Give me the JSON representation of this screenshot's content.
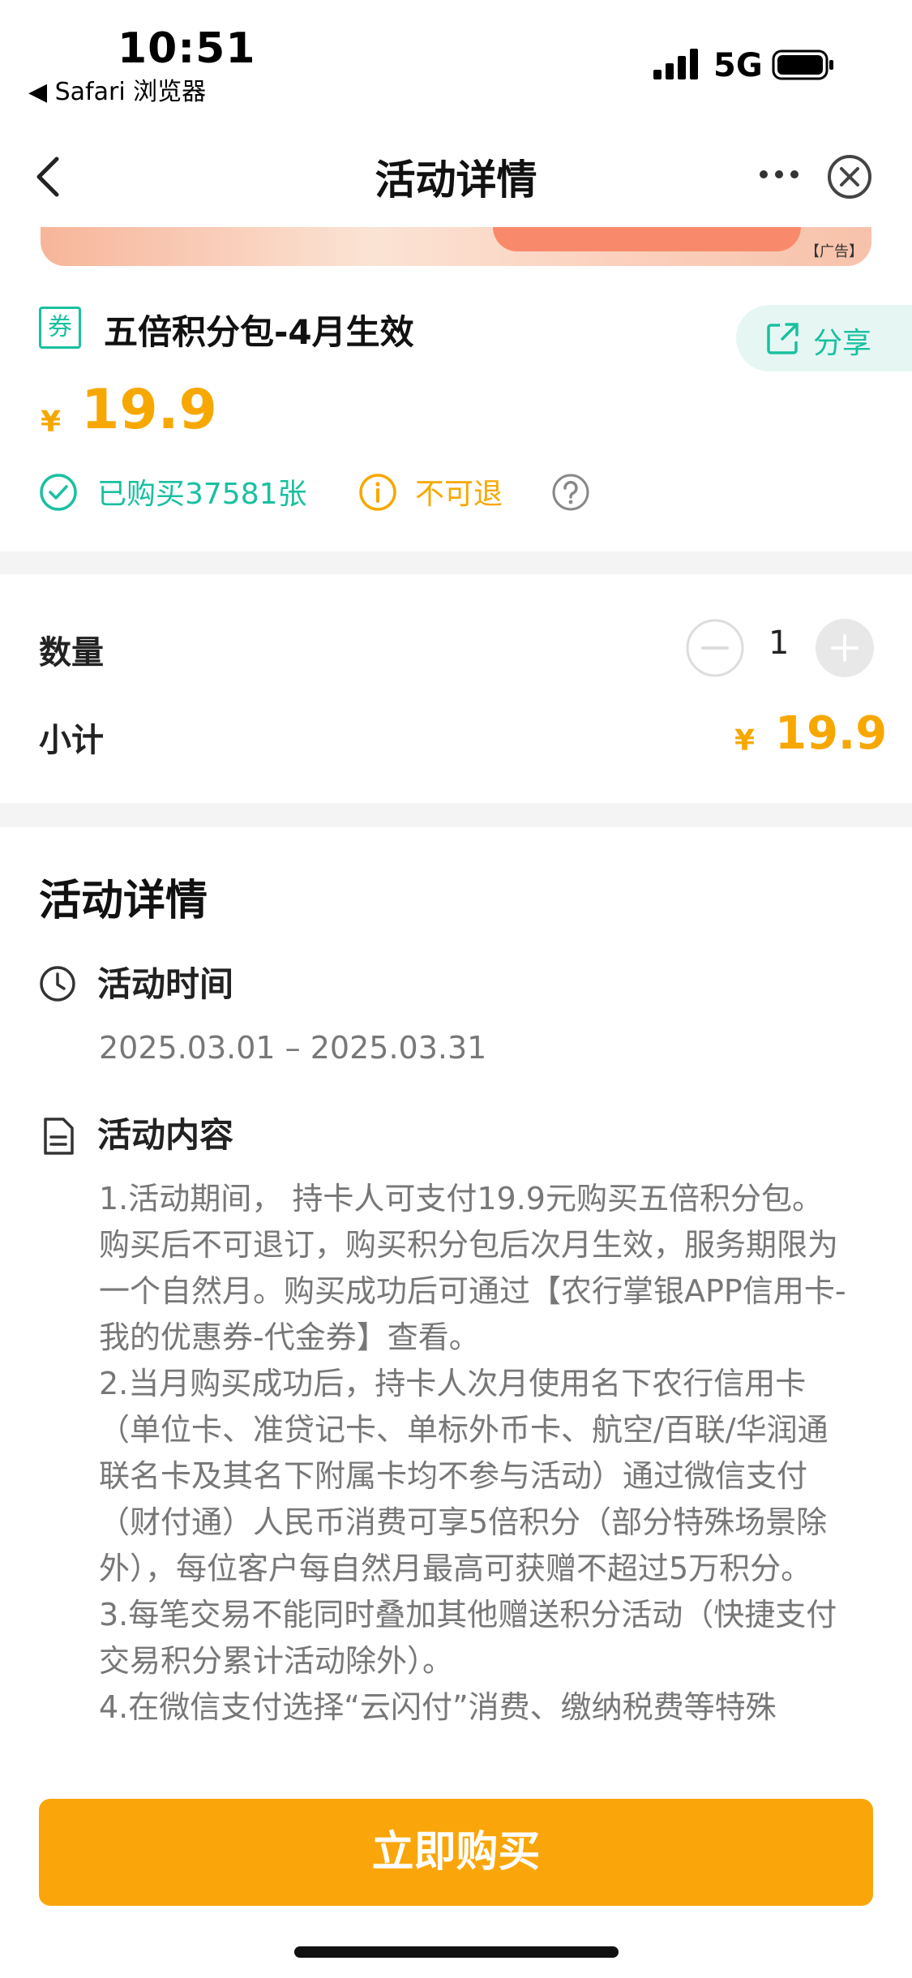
{
  "status_bar": {
    "time": "10:51",
    "back_app": "◀ Safari 浏览器",
    "network": "5G"
  },
  "nav": {
    "title": "活动详情"
  },
  "banner": {
    "ad_tag": "【广告】"
  },
  "product": {
    "coupon_icon_text": "券",
    "title": "五倍积分包-4月生效",
    "share_label": "分享",
    "currency": "¥",
    "price": "19.9",
    "sold": "已购买37581张",
    "refund": "不可退"
  },
  "order": {
    "quantity_label": "数量",
    "quantity": "1",
    "subtotal_label": "小计",
    "currency": "¥",
    "subtotal": "19.9"
  },
  "details": {
    "title": "活动详情",
    "time_label": "活动时间",
    "time_range": "2025.03.01 – 2025.03.31",
    "content_label": "活动内容",
    "content": [
      "1.活动期间， 持卡人可支付19.9元购买五倍积分包。购买后不可退订，购买积分包后次月生效，服务期限为一个自然月。购买成功后可通过【农行掌银APP信用卡-我的优惠券-代金券】查看。",
      "2.当月购买成功后，持卡人次月使用名下农行信用卡（单位卡、准贷记卡、单标外币卡、航空/百联/华润通联名卡及其名下附属卡均不参与活动）通过微信支付（财付通）人民币消费可享5倍积分（部分特殊场景除外），每位客户每自然月最高可获赠不超过5万积分。",
      "3.每笔交易不能同时叠加其他赠送积分活动（快捷支付交易积分累计活动除外）。",
      "4.在微信支付选择“云闪付”消费、缴纳税费等特殊"
    ]
  },
  "buy_button": "立即购买",
  "colors": {
    "accent": "#faa60b",
    "teal": "#19c0a0",
    "price": "#f7a800"
  }
}
